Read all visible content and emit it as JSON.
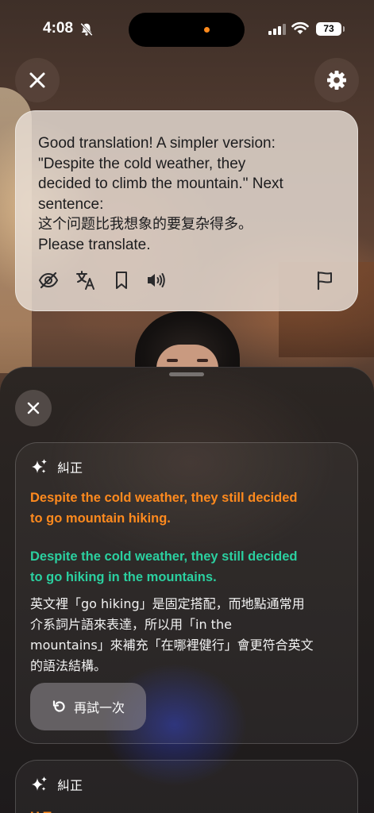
{
  "status_bar": {
    "time": "4:08",
    "battery": "73",
    "icons": [
      "bell-slash-icon",
      "cellular-signal-icon",
      "wifi-icon",
      "battery-icon"
    ],
    "island_indicator_color": "#ff8a1c"
  },
  "top_controls": {
    "close_icon": "close-icon",
    "settings_icon": "gear-icon"
  },
  "message": {
    "lines": [
      "Good translation! A simpler version:",
      "\"Despite the cold weather, they",
      "decided to climb the mountain.\" Next",
      "sentence:",
      "这个问题比我想象的要复杂得多。",
      "Please translate."
    ],
    "actions": [
      "eye-slash-icon",
      "translate-icon",
      "bookmark-icon",
      "speaker-icon",
      "flag-icon"
    ]
  },
  "sheet": {
    "close_icon": "close-icon",
    "cards": [
      {
        "title": "糾正",
        "icon": "sparkles-icon",
        "original_lines": [
          "Despite the cold weather, they still decided",
          "to go mountain hiking."
        ],
        "corrected_lines": [
          "Despite the cold weather, they still decided",
          "to go hiking in the mountains."
        ],
        "explanation_lines": [
          "英文裡「go hiking」是固定搭配，而地點通常用",
          "介系詞片語來表達，所以用「in the",
          "mountains」來補充「在哪裡健行」會更符合英文",
          "的語法結構。"
        ],
        "retry_label": "再試一次"
      },
      {
        "title": "糾正",
        "icon": "sparkles-icon",
        "original_partial": "H         T"
      }
    ]
  },
  "colors": {
    "original_text": "#ff8a1e",
    "corrected_text": "#2bd0a0",
    "bubble_bg": "#e8ded6"
  }
}
